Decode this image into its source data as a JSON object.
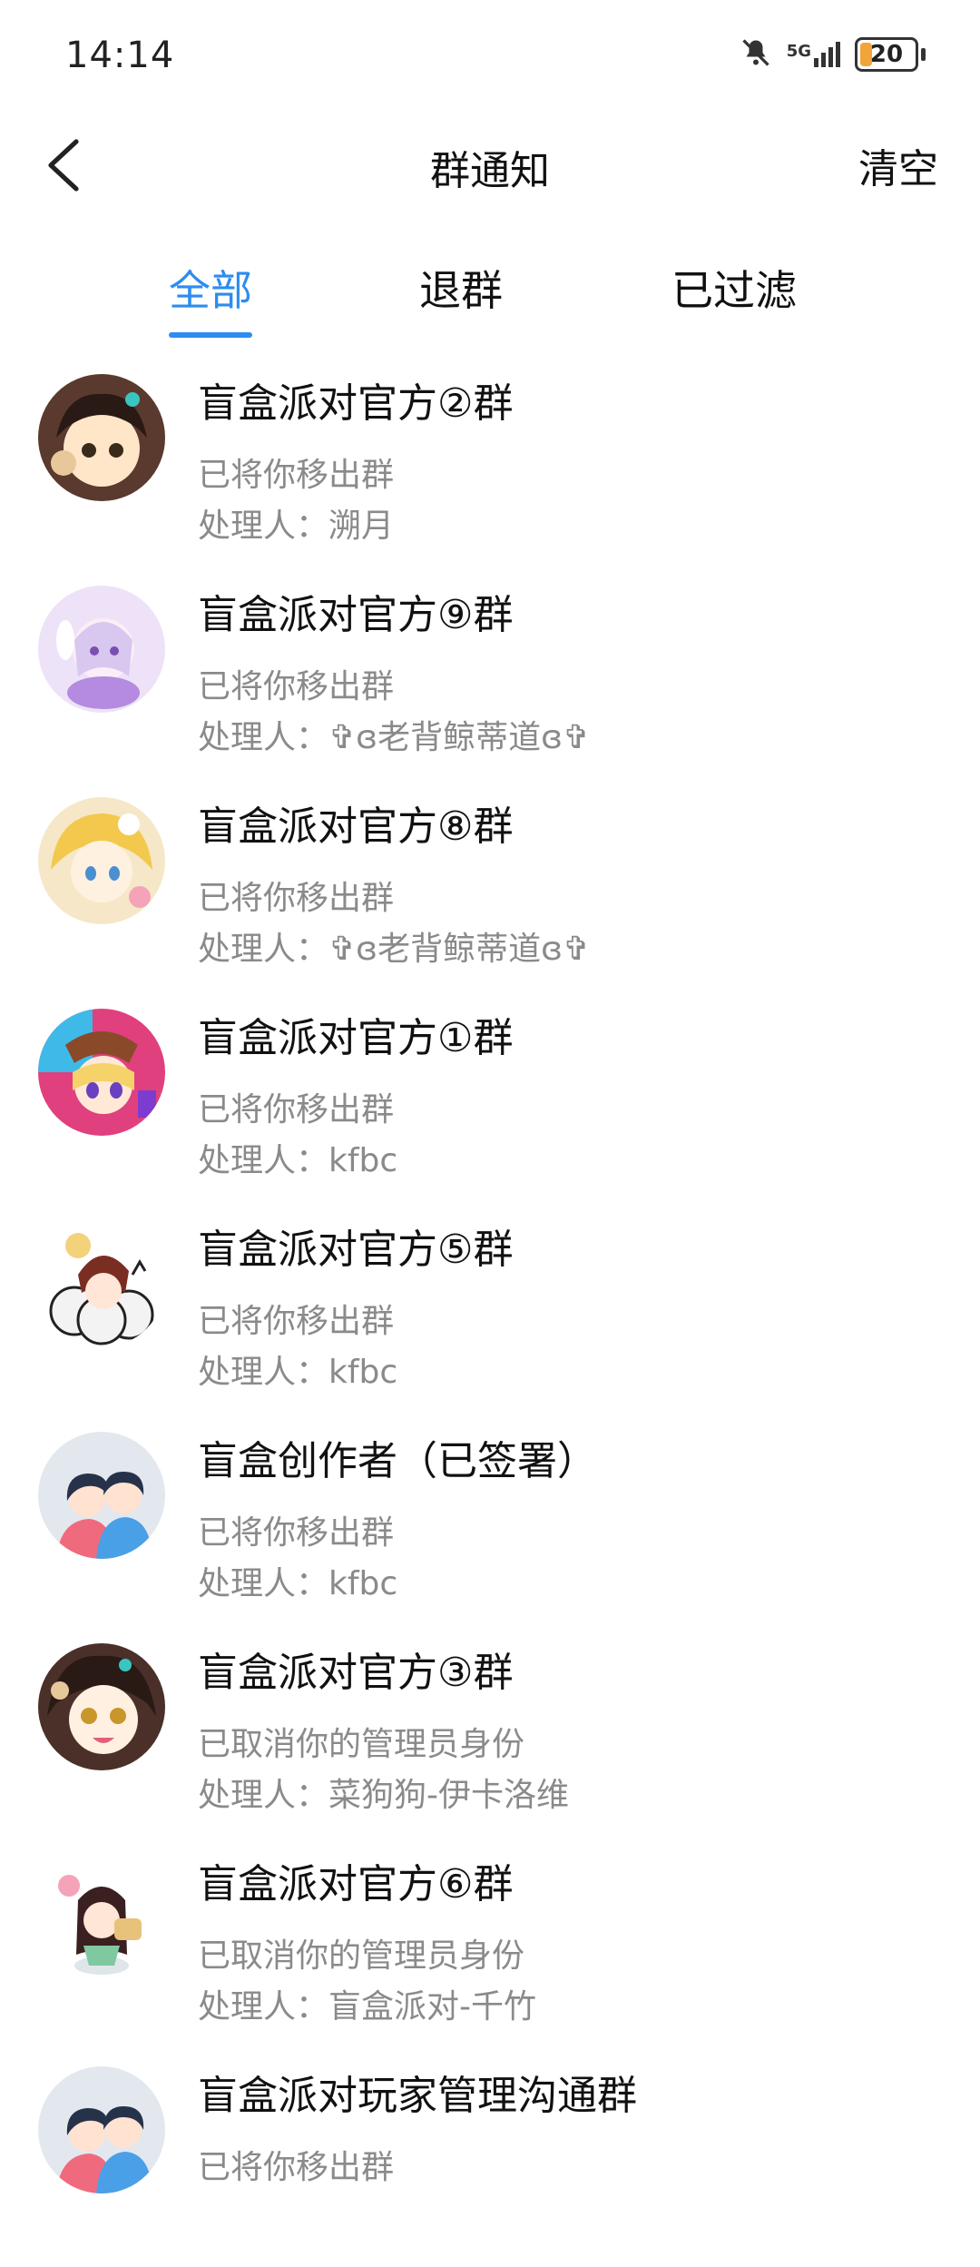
{
  "status_bar": {
    "time": "14:14",
    "network": "5G",
    "battery": "20",
    "icons": [
      "mute-bell-icon",
      "5g-signal-icon",
      "battery-icon"
    ]
  },
  "header": {
    "back_icon": "chevron-left-icon",
    "title": "群通知",
    "clear_label": "清空"
  },
  "tabs": [
    {
      "label": "全部",
      "active": true
    },
    {
      "label": "退群",
      "active": false
    },
    {
      "label": "已过滤",
      "active": false
    }
  ],
  "colors": {
    "accent": "#2d8cf0",
    "secondary_text": "#8a8a8a"
  },
  "notifications": [
    {
      "title": "盲盒派对官方②群",
      "action": "已将你移出群",
      "handler": "处理人：溯月",
      "avatar": "anime-girl-avatar"
    },
    {
      "title": "盲盒派对官方⑨群",
      "action": "已将你移出群",
      "handler": "处理人：✞ɞ老背鲸蒂道ɞ✞",
      "avatar": "anime-girl-avatar"
    },
    {
      "title": "盲盒派对官方⑧群",
      "action": "已将你移出群",
      "handler": "处理人：✞ɞ老背鲸蒂道ɞ✞",
      "avatar": "anime-girl-avatar"
    },
    {
      "title": "盲盒派对官方①群",
      "action": "已将你移出群",
      "handler": "处理人：kfbc",
      "avatar": "anime-girl-avatar"
    },
    {
      "title": "盲盒派对官方⑤群",
      "action": "已将你移出群",
      "handler": "处理人：kfbc",
      "avatar": "anime-girl-avatar"
    },
    {
      "title": "盲盒创作者（已签署）",
      "action": "已将你移出群",
      "handler": "处理人：kfbc",
      "avatar": "default-group-avatar"
    },
    {
      "title": "盲盒派对官方③群",
      "action": "已取消你的管理员身份",
      "handler": "处理人：菜狗狗-伊卡洛维",
      "avatar": "anime-girl-avatar"
    },
    {
      "title": "盲盒派对官方⑥群",
      "action": "已取消你的管理员身份",
      "handler": "处理人：盲盒派对-千竹",
      "avatar": "anime-girl-avatar"
    },
    {
      "title": "盲盒派对玩家管理沟通群",
      "action": "已将你移出群",
      "handler": "",
      "avatar": "default-group-avatar"
    }
  ]
}
